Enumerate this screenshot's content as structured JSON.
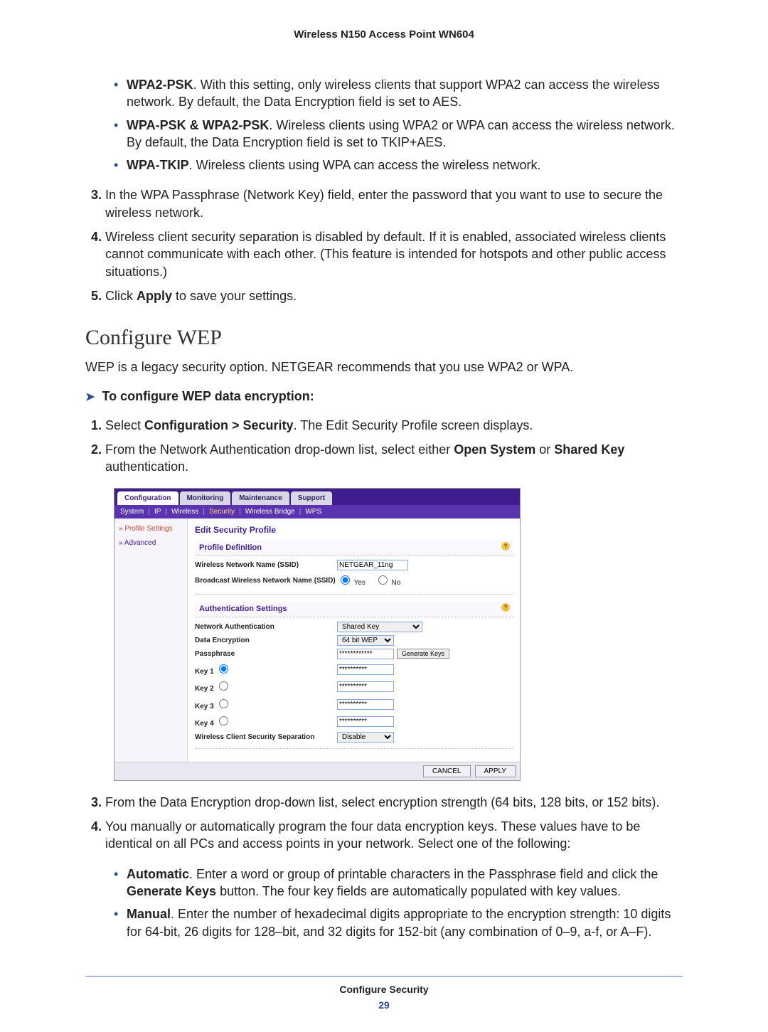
{
  "doc_title": "Wireless N150 Access Point WN604",
  "bullets_top": {
    "b0": {
      "strong": "WPA2-PSK",
      "text": ". With this setting, only wireless clients that support WPA2 can access the wireless network. By default, the Data Encryption field is set to AES."
    },
    "b1": {
      "strong": "WPA-PSK & WPA2-PSK",
      "text": ". Wireless clients using WPA2 or WPA can access the wireless network. By default, the Data Encryption field is set to TKIP+AES."
    },
    "b2": {
      "strong": "WPA-TKIP",
      "text": ". Wireless clients using WPA can access the wireless network."
    }
  },
  "steps_top": {
    "s3": "In the WPA Passphrase (Network Key) field, enter the password that you want to use to secure the wireless network.",
    "s4": "Wireless client security separation is disabled by default. If it is enabled, associated wireless clients cannot communicate with each other. (This feature is intended for hotspots and other public access situations.)",
    "s5_pre": "Click ",
    "s5_strong": "Apply",
    "s5_post": " to save your settings."
  },
  "section_heading": "Configure WEP",
  "section_intro": "WEP is a legacy security option. NETGEAR recommends that you use WPA2 or WPA.",
  "proc_heading": "To configure WEP data encryption:",
  "proc_steps": {
    "p1_pre": "Select ",
    "p1_strong": "Configuration > Security",
    "p1_post": ". The Edit Security Profile screen displays.",
    "p2_pre": "From the Network Authentication drop-down list, select either ",
    "p2_s1": "Open System",
    "p2_mid": " or ",
    "p2_s2": "Shared Key",
    "p2_post": " authentication.",
    "p3": "From the Data Encryption drop-down list, select encryption strength (64 bits, 128 bits, or 152 bits).",
    "p4": "You manually or automatically program the four data encryption keys. These values have to be identical on all PCs and access points in your network. Select one of the following:"
  },
  "proc_sub": {
    "a_strong": "Automatic",
    "a_text": ". Enter a word or group of printable characters in the Passphrase field and click the ",
    "a_strong2": "Generate Keys",
    "a_text2": " button. The four key fields are automatically populated with key values.",
    "m_strong": "Manual",
    "m_text": ". Enter the number of hexadecimal digits appropriate to the encryption strength: 10 digits for 64-bit, 26 digits for 128–bit, and 32 digits for 152-bit (any combination of 0–9, a-f, or A–F)."
  },
  "shot": {
    "tabs": {
      "t0": "Configuration",
      "t1": "Monitoring",
      "t2": "Maintenance",
      "t3": "Support"
    },
    "subnav": {
      "n0": "System",
      "n1": "IP",
      "n2": "Wireless",
      "n3": "Security",
      "n4": "Wireless Bridge",
      "n5": "WPS"
    },
    "sidebar": {
      "profile": "Profile Settings",
      "advanced": "Advanced"
    },
    "panel_title": "Edit Security Profile",
    "pd_title": "Profile Definition",
    "ssid_label": "Wireless Network Name (SSID)",
    "ssid_value": "NETGEAR_11ng",
    "bcast_label": "Broadcast Wireless Network Name (SSID)",
    "yes": "Yes",
    "no": "No",
    "auth_title": "Authentication Settings",
    "na_label": "Network Authentication",
    "na_value": "Shared Key",
    "de_label": "Data Encryption",
    "de_value": "64 bit WEP",
    "pp_label": "Passphrase",
    "gen_label": "Generate Keys",
    "k1": "Key 1",
    "k2": "Key 2",
    "k3": "Key 3",
    "k4": "Key 4",
    "sep_label": "Wireless Client Security Separation",
    "sep_value": "Disable",
    "cancel": "CANCEL",
    "apply": "APPLY"
  },
  "footer": {
    "section": "Configure Security",
    "page": "29"
  }
}
